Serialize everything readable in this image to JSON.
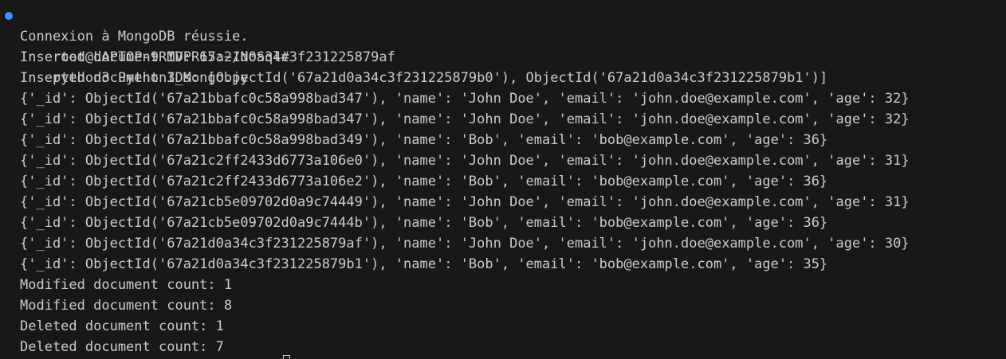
{
  "terminal": {
    "prompt": "root@LAPTOP-9RMVPR15:~/NoSql#",
    "command": "python3 Python3_Mongo.py",
    "decoration_color": "#3794ff",
    "output": [
      "Connexion à MongoDB réussie.",
      "Inserted document ID: 67a21d0a34c3f231225879af",
      "Inserted document IDs: [ObjectId('67a21d0a34c3f231225879b0'), ObjectId('67a21d0a34c3f231225879b1')]",
      "{'_id': ObjectId('67a21bbafc0c58a998bad347'), 'name': 'John Doe', 'email': 'john.doe@example.com', 'age': 32}",
      "{'_id': ObjectId('67a21bbafc0c58a998bad347'), 'name': 'John Doe', 'email': 'john.doe@example.com', 'age': 32}",
      "{'_id': ObjectId('67a21bbafc0c58a998bad349'), 'name': 'Bob', 'email': 'bob@example.com', 'age': 36}",
      "{'_id': ObjectId('67a21c2ff2433d6773a106e0'), 'name': 'John Doe', 'email': 'john.doe@example.com', 'age': 31}",
      "{'_id': ObjectId('67a21c2ff2433d6773a106e2'), 'name': 'Bob', 'email': 'bob@example.com', 'age': 36}",
      "{'_id': ObjectId('67a21cb5e09702d0a9c74449'), 'name': 'John Doe', 'email': 'john.doe@example.com', 'age': 31}",
      "{'_id': ObjectId('67a21cb5e09702d0a9c7444b'), 'name': 'Bob', 'email': 'bob@example.com', 'age': 36}",
      "{'_id': ObjectId('67a21d0a34c3f231225879af'), 'name': 'John Doe', 'email': 'john.doe@example.com', 'age': 30}",
      "{'_id': ObjectId('67a21d0a34c3f231225879b1'), 'name': 'Bob', 'email': 'bob@example.com', 'age': 35}",
      "Modified document count: 1",
      "Modified document count: 8",
      "Deleted document count: 1",
      "Deleted document count: 7"
    ]
  }
}
